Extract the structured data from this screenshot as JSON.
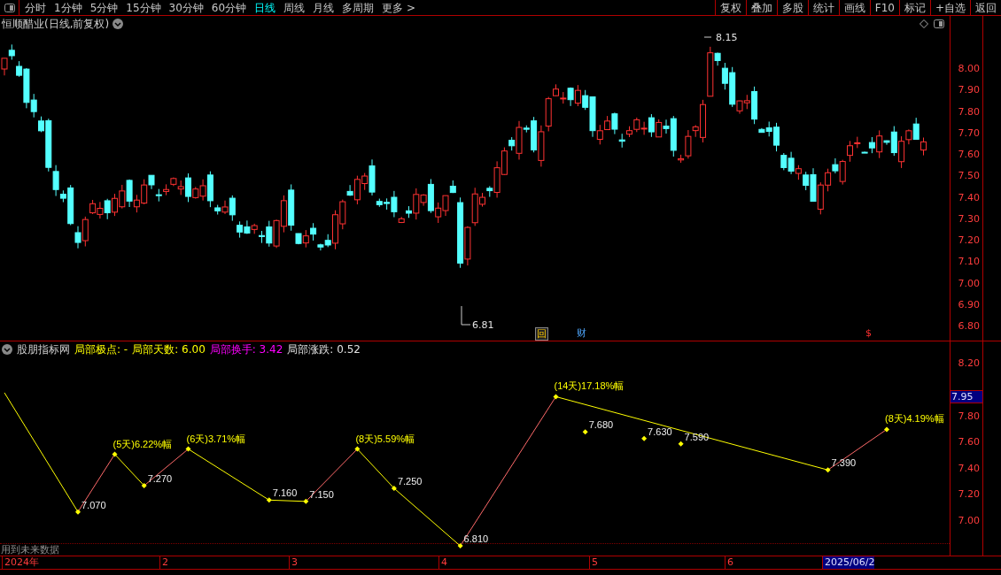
{
  "toolbar": {
    "periods": [
      {
        "label": "分时",
        "selected": false
      },
      {
        "label": "1分钟",
        "selected": false
      },
      {
        "label": "5分钟",
        "selected": false
      },
      {
        "label": "15分钟",
        "selected": false
      },
      {
        "label": "30分钟",
        "selected": false
      },
      {
        "label": "60分钟",
        "selected": false
      },
      {
        "label": "日线",
        "selected": true
      },
      {
        "label": "周线",
        "selected": false
      },
      {
        "label": "月线",
        "selected": false
      },
      {
        "label": "多周期",
        "selected": false
      }
    ],
    "more": "更多 >",
    "actions": [
      "复权",
      "叠加",
      "多股",
      "统计",
      "画线",
      "F10",
      "标记",
      "+自选",
      "返回"
    ]
  },
  "main_chart": {
    "title": "恒顺醋业(日线,前复权)",
    "price_axis": [
      "8.00",
      "7.90",
      "7.80",
      "7.70",
      "7.60",
      "7.50",
      "7.40",
      "7.30",
      "7.20",
      "7.10",
      "7.00",
      "6.90",
      "6.80"
    ],
    "high_label": "8.15",
    "low_label": "6.81",
    "markers": [
      {
        "label": "回",
        "kind": "box"
      },
      {
        "label": "财",
        "kind": "text"
      },
      {
        "label": "$",
        "kind": "signal"
      }
    ]
  },
  "indicator": {
    "name": "股朋指标网",
    "readouts": [
      {
        "label": "局部极点: -",
        "color": "#ffff00"
      },
      {
        "label": "局部天数: 6.00",
        "color": "#ffff00"
      },
      {
        "label": "局部换手: 3.42",
        "color": "#ff00ff"
      },
      {
        "label": "局部涨跌: 0.52",
        "color": "#e0e0e0"
      }
    ],
    "current_price": "7.95",
    "axis": [
      "8.20",
      "7.80",
      "7.60",
      "7.40",
      "7.20",
      "7.00"
    ],
    "point_labels": [
      {
        "text": "7.070",
        "kind": "price"
      },
      {
        "text": "(5天)6.22%幅",
        "kind": "swing"
      },
      {
        "text": "7.270",
        "kind": "price"
      },
      {
        "text": "(6天)3.71%幅",
        "kind": "swing"
      },
      {
        "text": "7.160",
        "kind": "price"
      },
      {
        "text": "7.150",
        "kind": "price"
      },
      {
        "text": "(8天)5.59%幅",
        "kind": "swing"
      },
      {
        "text": "7.250",
        "kind": "price"
      },
      {
        "text": "6.810",
        "kind": "price"
      },
      {
        "text": "(14天)17.18%幅",
        "kind": "swing"
      },
      {
        "text": "7.680",
        "kind": "price"
      },
      {
        "text": "7.630",
        "kind": "price"
      },
      {
        "text": "7.590",
        "kind": "price"
      },
      {
        "text": "7.390",
        "kind": "price"
      },
      {
        "text": "(8天)4.19%幅",
        "kind": "swing"
      }
    ],
    "note": "用到未来数据"
  },
  "date_axis": [
    {
      "label": "2024年",
      "selected": false
    },
    {
      "label": "2",
      "selected": false
    },
    {
      "label": "3",
      "selected": false
    },
    {
      "label": "4",
      "selected": false
    },
    {
      "label": "5",
      "selected": false
    },
    {
      "label": "6",
      "selected": false
    },
    {
      "label": "2025/06/2",
      "selected": true
    }
  ]
}
